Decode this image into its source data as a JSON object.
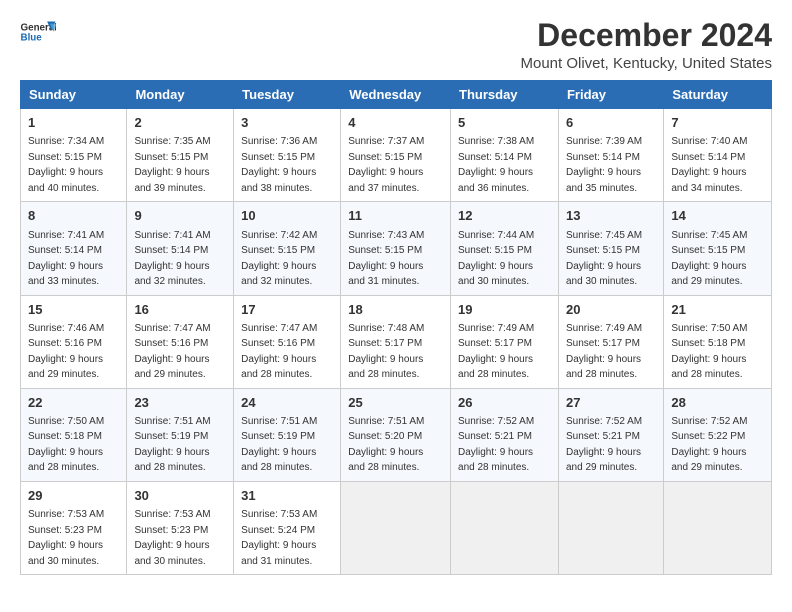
{
  "logo": {
    "line1": "General",
    "line2": "Blue"
  },
  "title": "December 2024",
  "subtitle": "Mount Olivet, Kentucky, United States",
  "days_header": [
    "Sunday",
    "Monday",
    "Tuesday",
    "Wednesday",
    "Thursday",
    "Friday",
    "Saturday"
  ],
  "weeks": [
    [
      {
        "day": "1",
        "detail": "Sunrise: 7:34 AM\nSunset: 5:15 PM\nDaylight: 9 hours\nand 40 minutes."
      },
      {
        "day": "2",
        "detail": "Sunrise: 7:35 AM\nSunset: 5:15 PM\nDaylight: 9 hours\nand 39 minutes."
      },
      {
        "day": "3",
        "detail": "Sunrise: 7:36 AM\nSunset: 5:15 PM\nDaylight: 9 hours\nand 38 minutes."
      },
      {
        "day": "4",
        "detail": "Sunrise: 7:37 AM\nSunset: 5:15 PM\nDaylight: 9 hours\nand 37 minutes."
      },
      {
        "day": "5",
        "detail": "Sunrise: 7:38 AM\nSunset: 5:14 PM\nDaylight: 9 hours\nand 36 minutes."
      },
      {
        "day": "6",
        "detail": "Sunrise: 7:39 AM\nSunset: 5:14 PM\nDaylight: 9 hours\nand 35 minutes."
      },
      {
        "day": "7",
        "detail": "Sunrise: 7:40 AM\nSunset: 5:14 PM\nDaylight: 9 hours\nand 34 minutes."
      }
    ],
    [
      {
        "day": "8",
        "detail": "Sunrise: 7:41 AM\nSunset: 5:14 PM\nDaylight: 9 hours\nand 33 minutes."
      },
      {
        "day": "9",
        "detail": "Sunrise: 7:41 AM\nSunset: 5:14 PM\nDaylight: 9 hours\nand 32 minutes."
      },
      {
        "day": "10",
        "detail": "Sunrise: 7:42 AM\nSunset: 5:15 PM\nDaylight: 9 hours\nand 32 minutes."
      },
      {
        "day": "11",
        "detail": "Sunrise: 7:43 AM\nSunset: 5:15 PM\nDaylight: 9 hours\nand 31 minutes."
      },
      {
        "day": "12",
        "detail": "Sunrise: 7:44 AM\nSunset: 5:15 PM\nDaylight: 9 hours\nand 30 minutes."
      },
      {
        "day": "13",
        "detail": "Sunrise: 7:45 AM\nSunset: 5:15 PM\nDaylight: 9 hours\nand 30 minutes."
      },
      {
        "day": "14",
        "detail": "Sunrise: 7:45 AM\nSunset: 5:15 PM\nDaylight: 9 hours\nand 29 minutes."
      }
    ],
    [
      {
        "day": "15",
        "detail": "Sunrise: 7:46 AM\nSunset: 5:16 PM\nDaylight: 9 hours\nand 29 minutes."
      },
      {
        "day": "16",
        "detail": "Sunrise: 7:47 AM\nSunset: 5:16 PM\nDaylight: 9 hours\nand 29 minutes."
      },
      {
        "day": "17",
        "detail": "Sunrise: 7:47 AM\nSunset: 5:16 PM\nDaylight: 9 hours\nand 28 minutes."
      },
      {
        "day": "18",
        "detail": "Sunrise: 7:48 AM\nSunset: 5:17 PM\nDaylight: 9 hours\nand 28 minutes."
      },
      {
        "day": "19",
        "detail": "Sunrise: 7:49 AM\nSunset: 5:17 PM\nDaylight: 9 hours\nand 28 minutes."
      },
      {
        "day": "20",
        "detail": "Sunrise: 7:49 AM\nSunset: 5:17 PM\nDaylight: 9 hours\nand 28 minutes."
      },
      {
        "day": "21",
        "detail": "Sunrise: 7:50 AM\nSunset: 5:18 PM\nDaylight: 9 hours\nand 28 minutes."
      }
    ],
    [
      {
        "day": "22",
        "detail": "Sunrise: 7:50 AM\nSunset: 5:18 PM\nDaylight: 9 hours\nand 28 minutes."
      },
      {
        "day": "23",
        "detail": "Sunrise: 7:51 AM\nSunset: 5:19 PM\nDaylight: 9 hours\nand 28 minutes."
      },
      {
        "day": "24",
        "detail": "Sunrise: 7:51 AM\nSunset: 5:19 PM\nDaylight: 9 hours\nand 28 minutes."
      },
      {
        "day": "25",
        "detail": "Sunrise: 7:51 AM\nSunset: 5:20 PM\nDaylight: 9 hours\nand 28 minutes."
      },
      {
        "day": "26",
        "detail": "Sunrise: 7:52 AM\nSunset: 5:21 PM\nDaylight: 9 hours\nand 28 minutes."
      },
      {
        "day": "27",
        "detail": "Sunrise: 7:52 AM\nSunset: 5:21 PM\nDaylight: 9 hours\nand 29 minutes."
      },
      {
        "day": "28",
        "detail": "Sunrise: 7:52 AM\nSunset: 5:22 PM\nDaylight: 9 hours\nand 29 minutes."
      }
    ],
    [
      {
        "day": "29",
        "detail": "Sunrise: 7:53 AM\nSunset: 5:23 PM\nDaylight: 9 hours\nand 30 minutes."
      },
      {
        "day": "30",
        "detail": "Sunrise: 7:53 AM\nSunset: 5:23 PM\nDaylight: 9 hours\nand 30 minutes."
      },
      {
        "day": "31",
        "detail": "Sunrise: 7:53 AM\nSunset: 5:24 PM\nDaylight: 9 hours\nand 31 minutes."
      },
      null,
      null,
      null,
      null
    ]
  ]
}
